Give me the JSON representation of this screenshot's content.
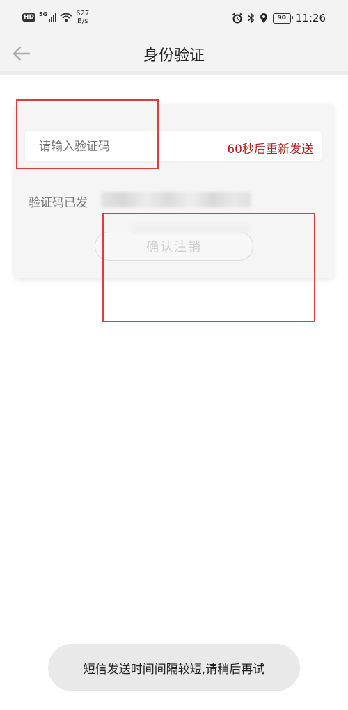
{
  "status_bar": {
    "network_type": "5G",
    "hd_label": "HD",
    "net_speed_value": "627",
    "net_speed_unit": "B/s",
    "battery": "90",
    "time": "11:26"
  },
  "nav": {
    "title": "身份验证",
    "back_icon": "arrow-left-icon"
  },
  "form": {
    "code_placeholder": "请输入验证码",
    "resend_countdown": "60秒后重新发送",
    "sent_info": "验证码已发",
    "confirm_label": "确认注销"
  },
  "toast": {
    "message": "短信发送时间间隔较短,请稍后再试"
  },
  "colors": {
    "accent_red": "#b22222",
    "annotation_red": "#e23b3b"
  }
}
